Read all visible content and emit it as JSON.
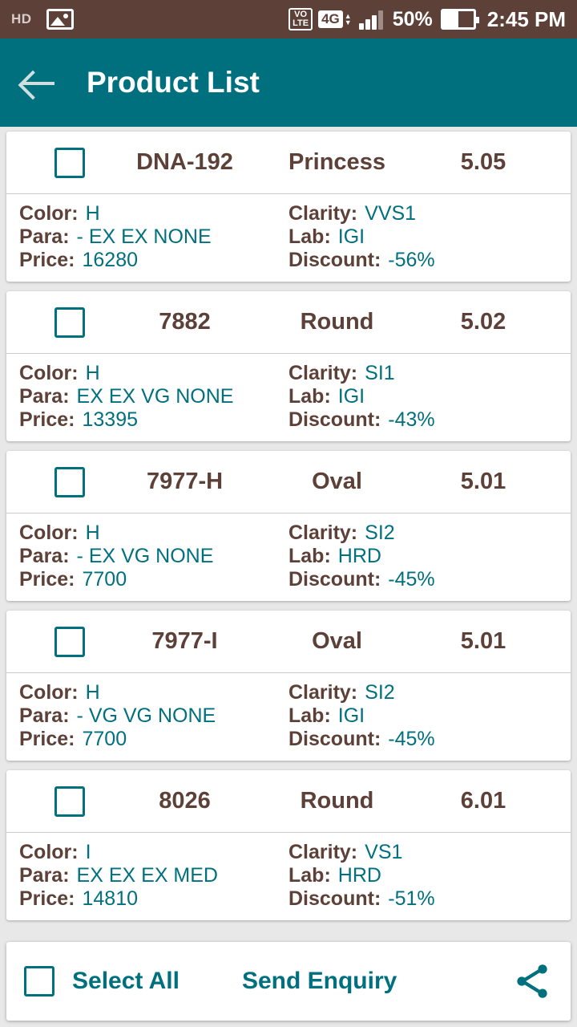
{
  "status_bar": {
    "hd_label": "HD",
    "image_icon": "photo-icon",
    "volte_top": "VO",
    "volte_bottom": "LTE",
    "network": "4G",
    "signal_icon": "signal-bars-icon",
    "battery_percent": "50%",
    "time": "2:45 PM"
  },
  "app_bar": {
    "back_icon": "back-arrow-icon",
    "title": "Product List"
  },
  "labels": {
    "color": "Color:",
    "clarity": "Clarity:",
    "para": "Para:",
    "lab": "Lab:",
    "price": "Price:",
    "discount": "Discount:"
  },
  "products": [
    {
      "name": "DNA-192",
      "shape": "Princess",
      "carat": "5.05",
      "color": "H",
      "clarity": "VVS1",
      "para": "-  EX  EX  NONE",
      "lab": "IGI",
      "price": "16280",
      "discount": "-56%"
    },
    {
      "name": "7882",
      "shape": "Round",
      "carat": "5.02",
      "color": "H",
      "clarity": "SI1",
      "para": "EX  EX  VG  NONE",
      "lab": "IGI",
      "price": "13395",
      "discount": "-43%"
    },
    {
      "name": "7977-H",
      "shape": "Oval",
      "carat": "5.01",
      "color": "H",
      "clarity": "SI2",
      "para": "-  EX  VG  NONE",
      "lab": "HRD",
      "price": "7700",
      "discount": "-45%"
    },
    {
      "name": "7977-I",
      "shape": "Oval",
      "carat": "5.01",
      "color": "H",
      "clarity": "SI2",
      "para": "-  VG  VG  NONE",
      "lab": "IGI",
      "price": "7700",
      "discount": "-45%"
    },
    {
      "name": "8026",
      "shape": "Round",
      "carat": "6.01",
      "color": "I",
      "clarity": "VS1",
      "para": "EX  EX  EX  MED",
      "lab": "HRD",
      "price": "14810",
      "discount": "-51%"
    }
  ],
  "bottom_bar": {
    "select_all": "Select All",
    "send_enquiry": "Send Enquiry",
    "share_icon": "share-icon"
  },
  "colors": {
    "status_bar": "#5d4037",
    "app_bar": "#00707f",
    "accent": "#00707f",
    "label": "#5d4037"
  }
}
